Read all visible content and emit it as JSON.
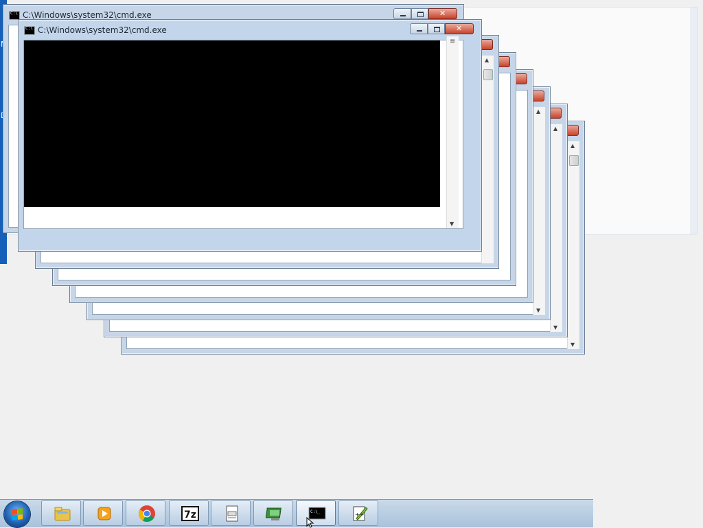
{
  "desktop": {
    "edge_letters": [
      "M",
      "D"
    ]
  },
  "windows": [
    {
      "title": "C:\\Windows\\system32\\cmd.exe",
      "role": "back"
    },
    {
      "title": "C:\\Windows\\system32\\cmd.exe",
      "role": "front"
    }
  ],
  "taskbar": {
    "items": [
      {
        "name": "windows-explorer",
        "icon": "folder-icon"
      },
      {
        "name": "media-player",
        "icon": "media-play-icon"
      },
      {
        "name": "chrome",
        "icon": "chrome-icon"
      },
      {
        "name": "7zip",
        "icon": "7zip-icon",
        "label": "7z"
      },
      {
        "name": "notepad-doc",
        "icon": "document-icon"
      },
      {
        "name": "remote-desktop",
        "icon": "monitor-icon"
      },
      {
        "name": "command-prompt",
        "icon": "cmd-icon",
        "label": "C:\\_"
      },
      {
        "name": "notepad-plus",
        "icon": "notepad-plus-icon"
      }
    ]
  },
  "colors": {
    "frame": "#c6d6e8",
    "close_red": "#c8432b",
    "console_bg": "#000000",
    "accent": "#1560b8"
  }
}
